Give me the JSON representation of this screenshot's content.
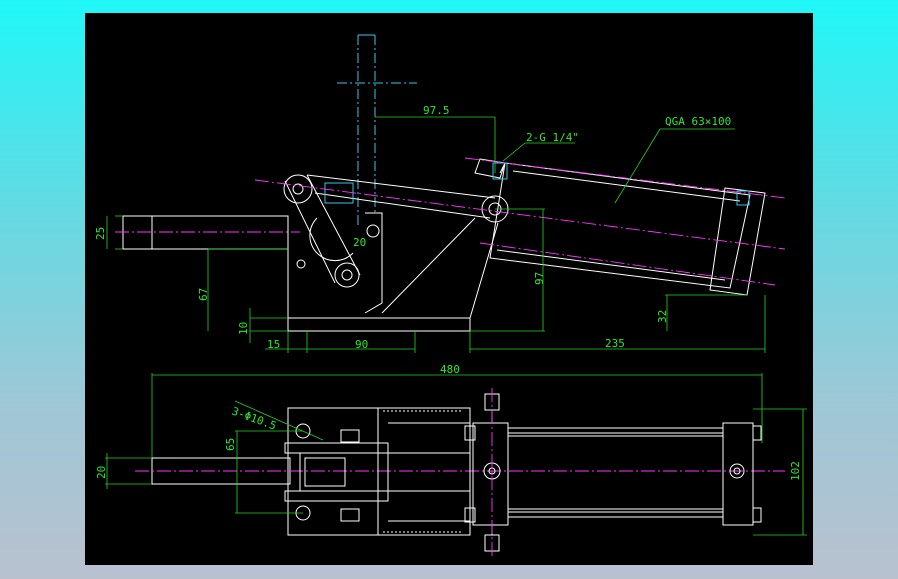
{
  "drawing": {
    "background": "#000000",
    "line_colors": {
      "outline": "#ffffff",
      "dimension": "#2ee82e",
      "centerline": "#ff33ff",
      "hidden": "#38c8e8"
    },
    "labels": {
      "cylinder": "QGA 63×100",
      "port": "2-G 1/4\"",
      "holes": "3-Φ10.5"
    },
    "dimensions": {
      "d97_5": "97.5",
      "d25": "25",
      "d20_top": "20",
      "d67": "67",
      "d10": "10",
      "d97": "97",
      "d32": "32",
      "d15": "15",
      "d90": "90",
      "d235": "235",
      "d480": "480",
      "d65": "65",
      "d20_left": "20",
      "d102": "102"
    }
  }
}
